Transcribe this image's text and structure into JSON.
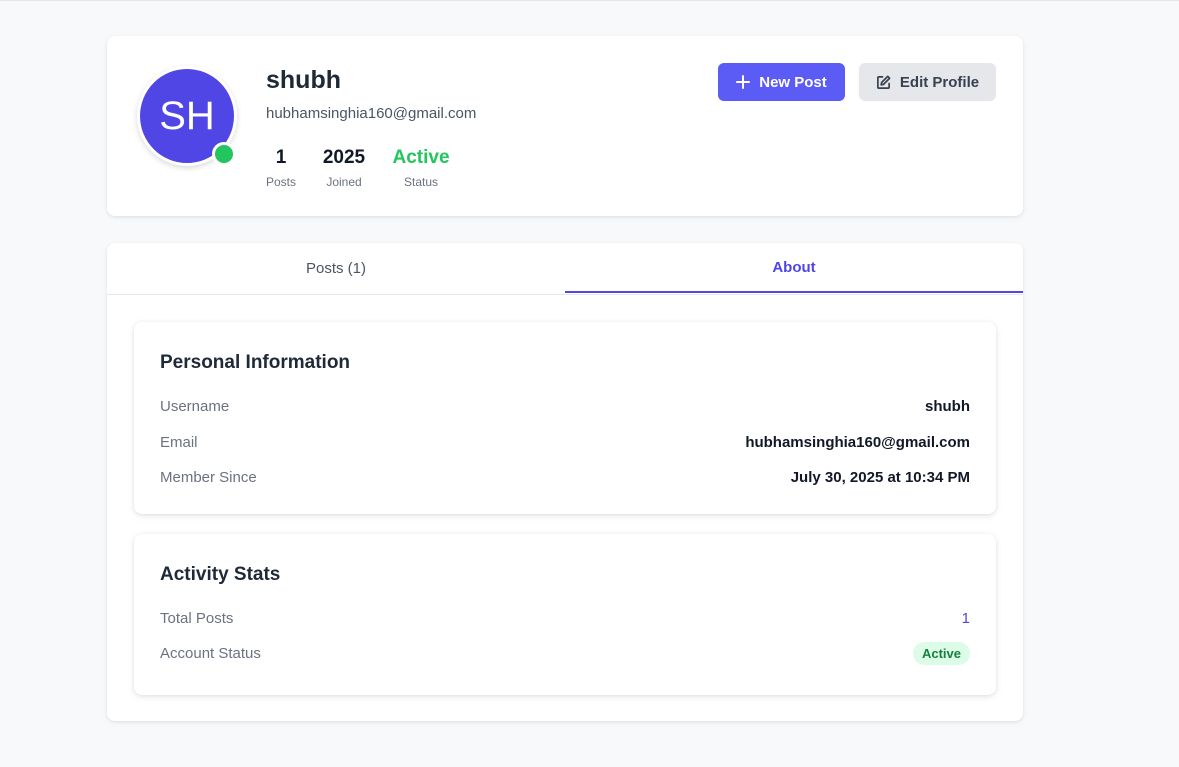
{
  "profile": {
    "initials": "SH",
    "name": "shubh",
    "email": "hubhamsinghia160@gmail.com",
    "stats": [
      {
        "value": "1",
        "label": "Posts"
      },
      {
        "value": "2025",
        "label": "Joined"
      },
      {
        "value": "Active",
        "label": "Status"
      }
    ],
    "online_color": "#22c55e",
    "avatar_color": "#4f46e5"
  },
  "actions": {
    "new_post_label": "New Post",
    "new_post_icon": "plus-icon",
    "edit_profile_label": "Edit Profile",
    "edit_profile_icon": "edit-icon"
  },
  "tabs": [
    {
      "label": "Posts (1)",
      "active": false
    },
    {
      "label": "About",
      "active": true
    }
  ],
  "personal_info": {
    "title": "Personal Information",
    "rows": [
      {
        "label": "Username",
        "value": "shubh"
      },
      {
        "label": "Email",
        "value": "hubhamsinghia160@gmail.com"
      },
      {
        "label": "Member Since",
        "value": "July 30, 2025 at 10:34 PM"
      }
    ]
  },
  "activity_stats": {
    "title": "Activity Stats",
    "total_posts_label": "Total Posts",
    "total_posts_value": "1",
    "account_status_label": "Account Status",
    "account_status_value": "Active"
  },
  "colors": {
    "accent": "#4f46e5",
    "primary_button": "#5b5bf6",
    "active_green": "#22c55e",
    "badge_bg": "#dcfce7",
    "badge_text": "#15803d"
  }
}
